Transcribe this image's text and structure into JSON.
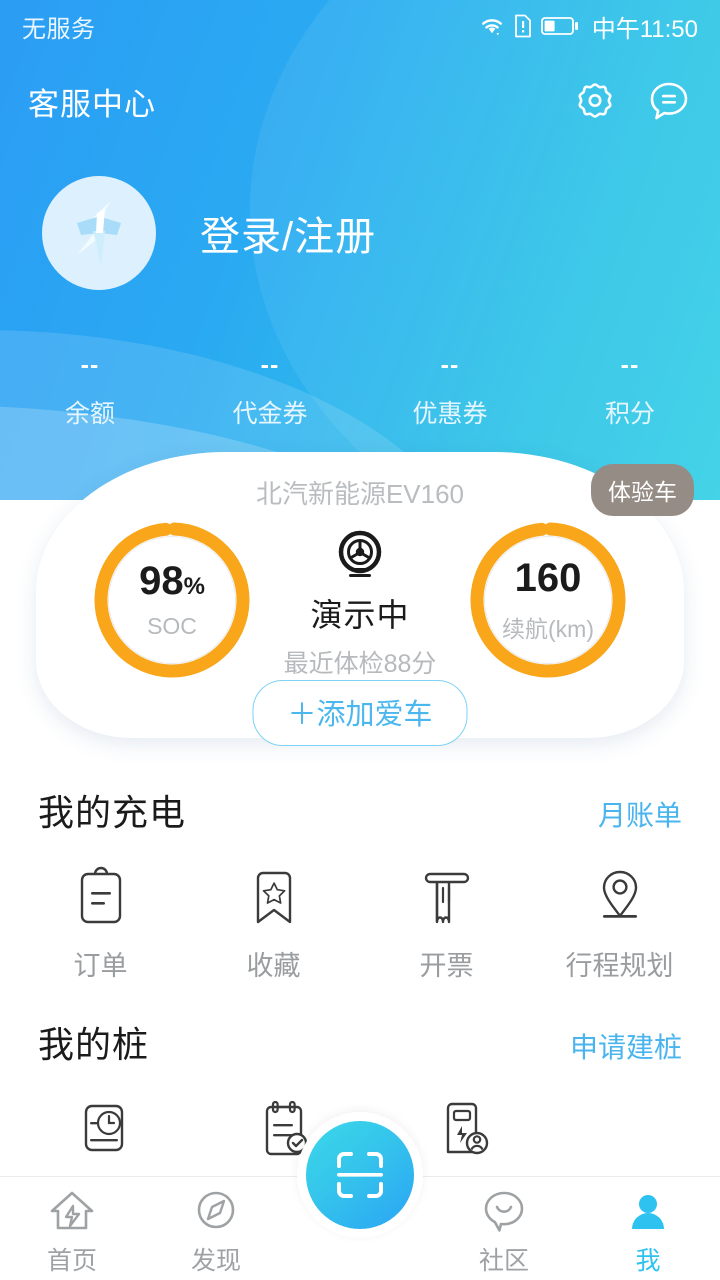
{
  "status_bar": {
    "carrier": "无服务",
    "time": "中午11:50",
    "icons": [
      "wifi-icon",
      "sim-alert-icon",
      "battery-icon"
    ],
    "battery_level_pct": 35
  },
  "header": {
    "title": "客服中心",
    "actions": [
      {
        "name": "settings-icon",
        "label": "设置"
      },
      {
        "name": "message-icon",
        "label": "消息"
      }
    ],
    "gradient_from": "#2b9df4",
    "gradient_to": "#36d0e6"
  },
  "profile": {
    "avatar_icon": "brand-logo-icon",
    "login_label": "登录/注册"
  },
  "stats": [
    {
      "value": "--",
      "label": "余额"
    },
    {
      "value": "--",
      "label": "代金券"
    },
    {
      "value": "--",
      "label": "优惠券"
    },
    {
      "value": "--",
      "label": "积分"
    }
  ],
  "car_card": {
    "model": "北汽新能源EV160",
    "badge": "体验车",
    "status": "演示中",
    "health": "最近体检88分",
    "add_car_label": "＋添加爱车",
    "ring_color": "#faa61a",
    "gauges": [
      {
        "value": "98",
        "unit": "%",
        "label": "SOC",
        "percent": 98
      },
      {
        "value": "160",
        "unit": "",
        "label": "续航(km)",
        "percent": 98
      }
    ]
  },
  "sections": [
    {
      "title": "我的充电",
      "link": "月账单",
      "items": [
        {
          "icon": "order-clipboard-icon",
          "label": "订单"
        },
        {
          "icon": "favorite-bookmark-icon",
          "label": "收藏"
        },
        {
          "icon": "invoice-icon",
          "label": "开票"
        },
        {
          "icon": "route-pin-icon",
          "label": "行程规划"
        }
      ]
    },
    {
      "title": "我的桩",
      "link": "申请建桩",
      "items": [
        {
          "icon": "pile-clock-icon",
          "label": ""
        },
        {
          "icon": "pile-checklist-icon",
          "label": ""
        },
        {
          "icon": "pile-user-icon",
          "label": ""
        }
      ]
    }
  ],
  "bottom_nav": {
    "items": [
      {
        "icon": "home-bolt-icon",
        "label": "首页",
        "active": false
      },
      {
        "icon": "compass-icon",
        "label": "发现",
        "active": false
      },
      {
        "icon": "scan-icon",
        "label": "",
        "active": false
      },
      {
        "icon": "community-chat-icon",
        "label": "社区",
        "active": false
      },
      {
        "icon": "profile-person-icon",
        "label": "我",
        "active": true
      }
    ],
    "active_color": "#2ec2f0",
    "inactive_color": "#9fa2a4"
  }
}
